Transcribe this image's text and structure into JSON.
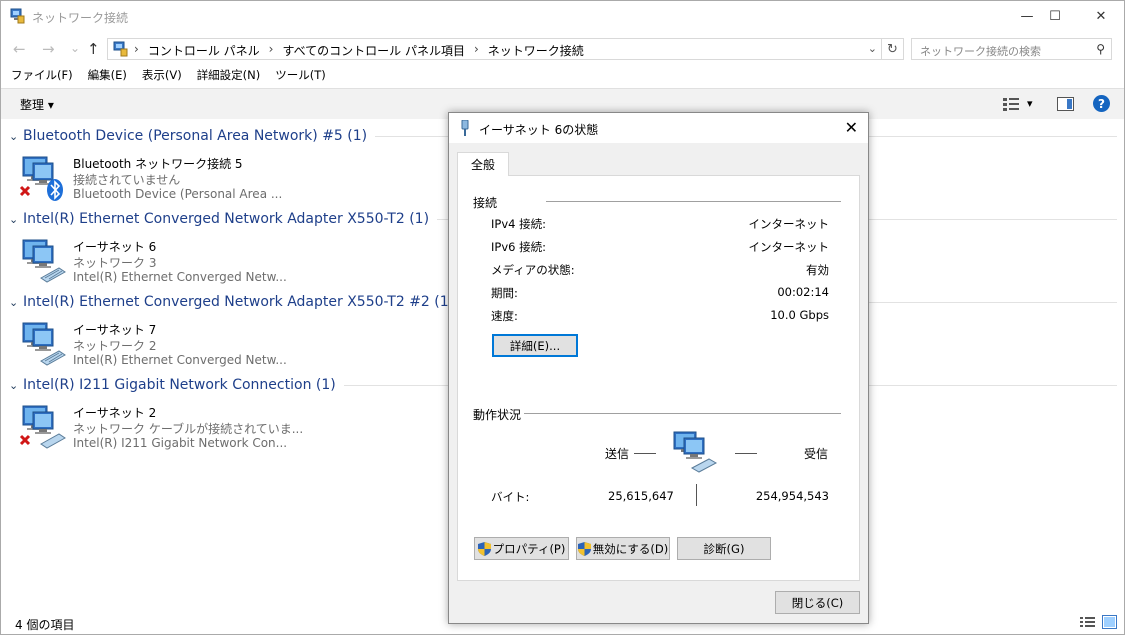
{
  "window": {
    "title": "ネットワーク接続",
    "minimize": "—",
    "maximize": "☐",
    "close": "✕"
  },
  "nav": {
    "back": "←",
    "forward": "→",
    "recent": "⌄",
    "up": "↑"
  },
  "address": {
    "crumbs": [
      "コントロール パネル",
      "すべてのコントロール パネル項目",
      "ネットワーク接続"
    ],
    "separator": "›",
    "dropdown": "⌄",
    "refresh": "↻"
  },
  "search": {
    "placeholder": "ネットワーク接続の検索",
    "icon": "⚲"
  },
  "menu": [
    "ファイル(F)",
    "編集(E)",
    "表示(V)",
    "詳細設定(N)",
    "ツール(T)"
  ],
  "toolbar": {
    "organize": "整理 ▾",
    "view_dd": "▾",
    "help": "?"
  },
  "groups": [
    {
      "title": "Bluetooth Device (Personal Area Network) #5 (1)",
      "item": {
        "name": "Bluetooth ネットワーク接続 5",
        "status": "接続されていません",
        "device": "Bluetooth Device (Personal Area ...",
        "icon": "bluetooth-network-icon",
        "disconnected": true
      }
    },
    {
      "title": "Intel(R) Ethernet Converged Network Adapter X550-T2 (1)",
      "item": {
        "name": "イーサネット 6",
        "status": "ネットワーク 3",
        "device": "Intel(R) Ethernet Converged Netw...",
        "icon": "ethernet-network-icon",
        "disconnected": false
      }
    },
    {
      "title": "Intel(R) Ethernet Converged Network Adapter X550-T2 #2 (1)",
      "item": {
        "name": "イーサネット 7",
        "status": "ネットワーク 2",
        "device": "Intel(R) Ethernet Converged Netw...",
        "icon": "ethernet-network-icon",
        "disconnected": false
      }
    },
    {
      "title": "Intel(R) I211 Gigabit Network Connection (1)",
      "item": {
        "name": "イーサネット 2",
        "status": "ネットワーク ケーブルが接続されていま...",
        "device": "Intel(R) I211 Gigabit Network Con...",
        "icon": "ethernet-network-icon",
        "disconnected": true
      }
    }
  ],
  "statusbar": {
    "count": "4 個の項目"
  },
  "dialog": {
    "title": "イーサネット 6の状態",
    "close": "✕",
    "tab": "全般",
    "connection": {
      "label": "接続",
      "rows": [
        {
          "k": "IPv4 接続:",
          "v": "インターネット"
        },
        {
          "k": "IPv6 接続:",
          "v": "インターネット"
        },
        {
          "k": "メディアの状態:",
          "v": "有効"
        },
        {
          "k": "期間:",
          "v": "00:02:14"
        },
        {
          "k": "速度:",
          "v": "10.0 Gbps"
        }
      ],
      "details_button": "詳細(E)..."
    },
    "activity": {
      "label": "動作状況",
      "sent": "送信",
      "received": "受信",
      "bytes_label": "バイト:",
      "bytes_sent": "25,615,647",
      "bytes_received": "254,954,543"
    },
    "buttons": {
      "properties": "プロパティ(P)",
      "disable": "無効にする(D)",
      "diagnose": "診断(G)",
      "close": "閉じる(C)"
    }
  }
}
